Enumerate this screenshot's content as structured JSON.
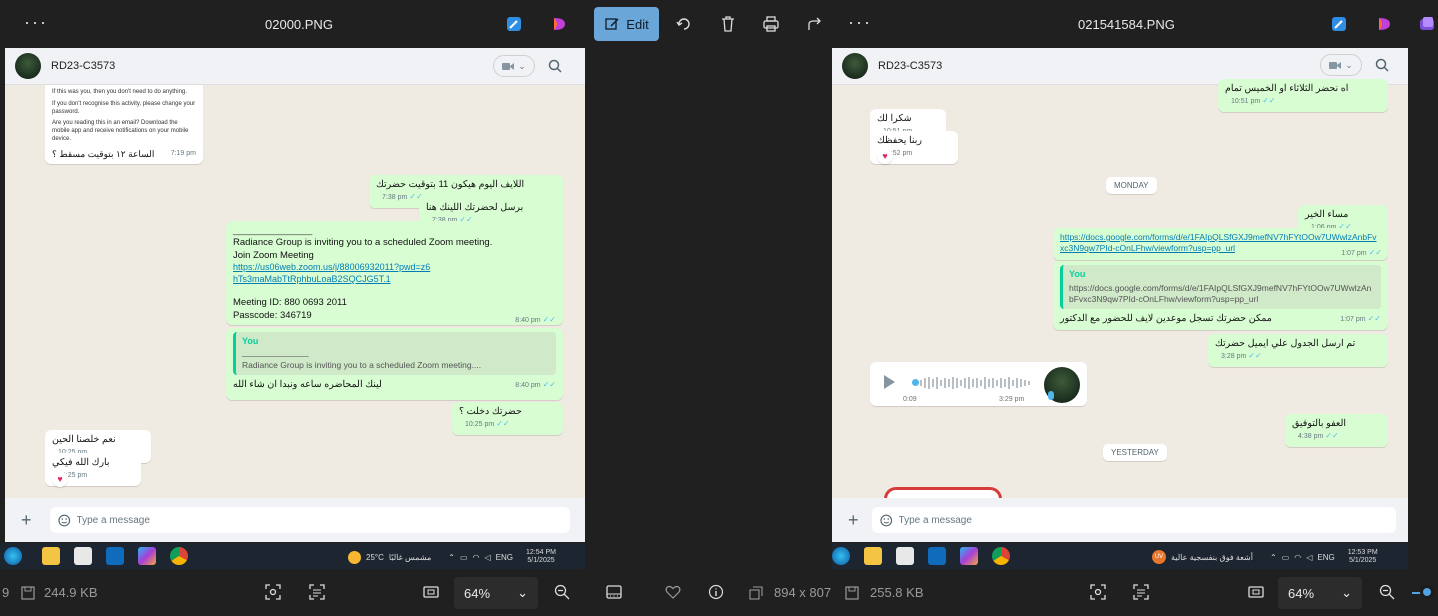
{
  "left": {
    "title": "02000.PNG",
    "contact": "RD23-C3573",
    "notice_lines": [
      "If this was you, then you don't need to do anything.",
      "If you don't recognise this activity, please change your password.",
      "Are you reading this in an email? Download the mobile app and receive notifications on your mobile device."
    ],
    "notice_text": "الساعة ١٢ بتوقيت مسقط ؟",
    "notice_time": "7:19 pm",
    "messages": {
      "m1": {
        "text": "اللايف اليوم هيكون 11 بتوقيت حضرتك",
        "time": "7:38 pm"
      },
      "m2": {
        "text": "برسل لحضرتك اللينك هنا",
        "time": "7:38 pm"
      },
      "zoom": {
        "sep": "_______________",
        "line1": "Radiance Group is inviting you to a scheduled Zoom meeting.",
        "line2": "Join Zoom Meeting",
        "link": "https://us06web.zoom.us/j/88006932011?pwd=z6hTs3maMabTtRphbuLoaB2SQCJG5T.1",
        "meeting_id": "Meeting ID: 880 0693 2011",
        "passcode": "Passcode: 346719",
        "time": "8:40 pm"
      },
      "reply": {
        "quote_who": "You",
        "quote_sep": "_______________",
        "quote_text": "Radiance Group is inviting you to a scheduled Zoom meeting....",
        "text": "لينك المحاضره ساعه ونبدا ان شاء الله",
        "time": "8:40 pm"
      },
      "m4": {
        "text": "حضرتك دخلت ؟",
        "time": "10:25 pm"
      },
      "in1": {
        "text": "نعم خلصنا الحين",
        "time": "10:25 pm"
      },
      "in2": {
        "text": "بارك الله فيكي",
        "time": "10:25 pm",
        "reaction": "♥"
      }
    },
    "placeholder": "Type a message",
    "weather": "25°C",
    "weather_text": "مشمس غالبًا",
    "lang": "ENG",
    "time": "12:54 PM",
    "date": "5/1/2025",
    "size": "244.9 KB",
    "page_prefix": "9",
    "zoom": "64%"
  },
  "right": {
    "title": "021541584.PNG",
    "contact": "RD23-C3573",
    "edit_label": "Edit",
    "messages": {
      "top": {
        "text": "اه نحضر الثلاثاء او الخميس تمام",
        "time": "10:51 pm"
      },
      "in1": {
        "text": "شكرا لك",
        "time": "10:51 pm"
      },
      "in2": {
        "text": "ربنا يحفظك",
        "time": "10:52 pm",
        "reaction": "♥"
      },
      "day1": "MONDAY",
      "m1": {
        "text": "مساء الخير",
        "time": "1:06 pm"
      },
      "m2": {
        "link": "https://docs.google.com/forms/d/e/1FAIpQLSfGXJ9mefNV7hFYtOOw7UWwlzAnbFvxc3N9qw7PId-cOnLFhw/viewform?usp=pp_url",
        "time": "1:07 pm"
      },
      "m3": {
        "quote_who": "You",
        "quote_text": "https://docs.google.com/forms/d/e/1FAIpQLSfGXJ9mefNV7hFYtOOw7UWwlzAnbFvxc3N9qw7PId-cOnLFhw/viewform?usp=pp_url",
        "text": "ممكن حضرتك تسجل موعدين لايف للحضور مع الدكتور",
        "time": "1:07 pm"
      },
      "m4": {
        "text": "تم ارسل الجدول علي ايميل حضرتك",
        "time": "3:28 pm"
      },
      "voice": {
        "duration": "0:09",
        "time": "3:29 pm"
      },
      "m5": {
        "text": "العفو بالتوفيق",
        "time": "4:38 pm"
      },
      "day2": "YESTERDAY"
    },
    "placeholder": "Type a message",
    "weather_badge": "UV",
    "weather_text": "أشعة فوق بنفسجية عالية",
    "lang": "ENG",
    "time": "12:53 PM",
    "date": "5/1/2025",
    "dimensions": "894 x 807",
    "size": "255.8 KB",
    "zoom": "64%"
  }
}
